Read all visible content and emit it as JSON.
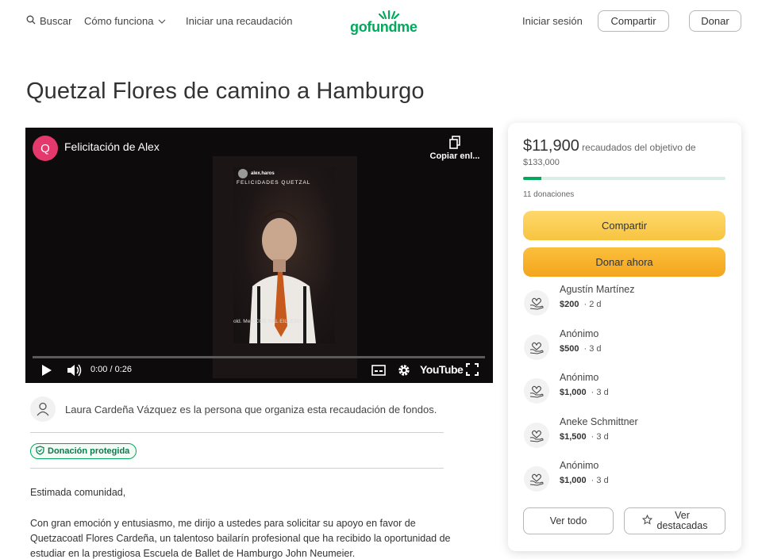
{
  "header": {
    "search_label": "Buscar",
    "how_it_works_label": "Cómo funciona",
    "start_fundraiser_label": "Iniciar una recaudación",
    "logo_text": "gofundme",
    "login_label": "Iniciar sesión",
    "share_label": "Compartir",
    "donate_label": "Donar"
  },
  "page_title": "Quetzal Flores de camino a Hamburgo",
  "video": {
    "avatar_letter": "Q",
    "title": "Felicitación de Alex",
    "copy_label": "Copiar enl...",
    "time": "0:00 / 0:26",
    "youtube_label": "YouTube",
    "overlay_user": "alex.haros",
    "overlay_caption": "FELICIDADES QUETZAL",
    "overlay_bottom": "old. MeXICOS MAL EILLESO"
  },
  "organizer": {
    "text": "Laura Cardeña Vázquez es la persona que organiza esta recaudación de fondos."
  },
  "badge": {
    "label": "Donación protegida"
  },
  "description": {
    "greeting": "Estimada comunidad,",
    "paragraph": "Con gran emoción y entusiasmo, me dirijo a ustedes para solicitar su apoyo en favor de Quetzacoatl Flores Cardeña, un talentoso bailarín profesional que ha recibido la oportunidad de estudiar en la prestigiosa Escuela de Ballet de Hamburgo John Neumeier."
  },
  "campaign": {
    "raised": "$11,900",
    "raised_suffix": "recaudados del objetivo de",
    "goal": "$133,000",
    "progress_fraction": 0.089,
    "donations_count": "11 donaciones",
    "share_button": "Compartir",
    "donate_button": "Donar ahora",
    "donations": [
      {
        "name": "Agustín Martínez",
        "amount": "$200",
        "ago": "2 d"
      },
      {
        "name": "Anónimo",
        "amount": "$500",
        "ago": "3 d"
      },
      {
        "name": "Anónimo",
        "amount": "$1,000",
        "ago": "3 d"
      },
      {
        "name": "Aneke Schmittner",
        "amount": "$1,500",
        "ago": "3 d"
      },
      {
        "name": "Anónimo",
        "amount": "$1,000",
        "ago": "3 d"
      }
    ],
    "see_all_button": "Ver todo",
    "see_featured_line1": "Ver",
    "see_featured_line2": "destacadas"
  },
  "colors": {
    "brand_green": "#02a95c",
    "share_yellow": "#f7c440",
    "donate_orange": "#f4a51d"
  }
}
